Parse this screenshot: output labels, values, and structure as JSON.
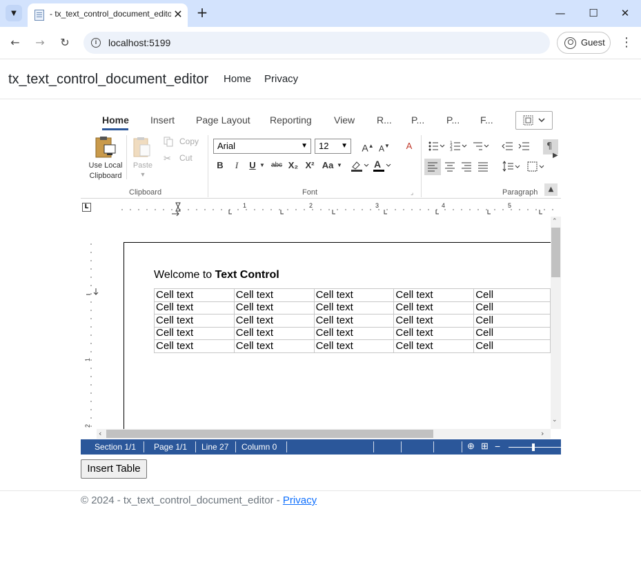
{
  "browser": {
    "tab_title": "- tx_text_control_document_editor",
    "url": "localhost:5199",
    "profile_label": "Guest",
    "icons": [
      "tab-search-icon",
      "favicon-document-icon",
      "close-icon",
      "new-tab-icon",
      "minimize-icon",
      "maximize-icon",
      "window-close-icon",
      "back-icon",
      "forward-icon",
      "reload-icon",
      "site-info-icon",
      "profile-icon",
      "more-menu-icon"
    ]
  },
  "site": {
    "brand": "tx_text_control_document_editor",
    "nav": [
      {
        "label": "Home"
      },
      {
        "label": "Privacy"
      }
    ]
  },
  "ribbon": {
    "tabs": [
      {
        "label": "Home"
      },
      {
        "label": "Insert"
      },
      {
        "label": "Page Layout"
      },
      {
        "label": "Reporting"
      },
      {
        "label": "View"
      },
      {
        "label": "R..."
      },
      {
        "label": "P..."
      },
      {
        "label": "P..."
      },
      {
        "label": "F..."
      }
    ],
    "active_tab": "Home",
    "clipboard": {
      "use_local_line1": "Use Local",
      "use_local_line2": "Clipboard",
      "paste": "Paste",
      "copy": "Copy",
      "cut": "Cut",
      "group_label": "Clipboard"
    },
    "font": {
      "family": "Arial",
      "size": "12",
      "group_label": "Font",
      "bold": "B",
      "italic": "I",
      "underline": "U",
      "strike": "abc",
      "subscript": "X₂",
      "superscript": "X²",
      "case": "Aa"
    },
    "paragraph": {
      "group_label": "Paragraph"
    },
    "accent_color": "#2b579a"
  },
  "ruler": {
    "h_numbers": [
      "1",
      "2",
      "3",
      "4",
      "5"
    ],
    "v_numbers": [
      "1",
      "2"
    ]
  },
  "document": {
    "welcome_prefix": "Welcome to ",
    "welcome_bold": "Text Control",
    "table": [
      [
        "Cell text",
        "Cell text",
        "Cell text",
        "Cell text",
        "Cell"
      ],
      [
        "Cell text",
        "Cell text",
        "Cell text",
        "Cell text",
        "Cell"
      ],
      [
        "Cell text",
        "Cell text",
        "Cell text",
        "Cell text",
        "Cell"
      ],
      [
        "Cell text",
        "Cell text",
        "Cell text",
        "Cell text",
        "Cell"
      ],
      [
        "Cell text",
        "Cell text",
        "Cell text",
        "Cell text",
        "Cell"
      ]
    ]
  },
  "statusbar": {
    "section": "Section 1/1",
    "page": "Page 1/1",
    "line": "Line 27",
    "column": "Column 0",
    "zoom_minus": "−",
    "zoom_level": 0.48
  },
  "insert_table_button": "Insert Table",
  "footer": {
    "text": "© 2024 - tx_text_control_document_editor - ",
    "link": "Privacy"
  }
}
